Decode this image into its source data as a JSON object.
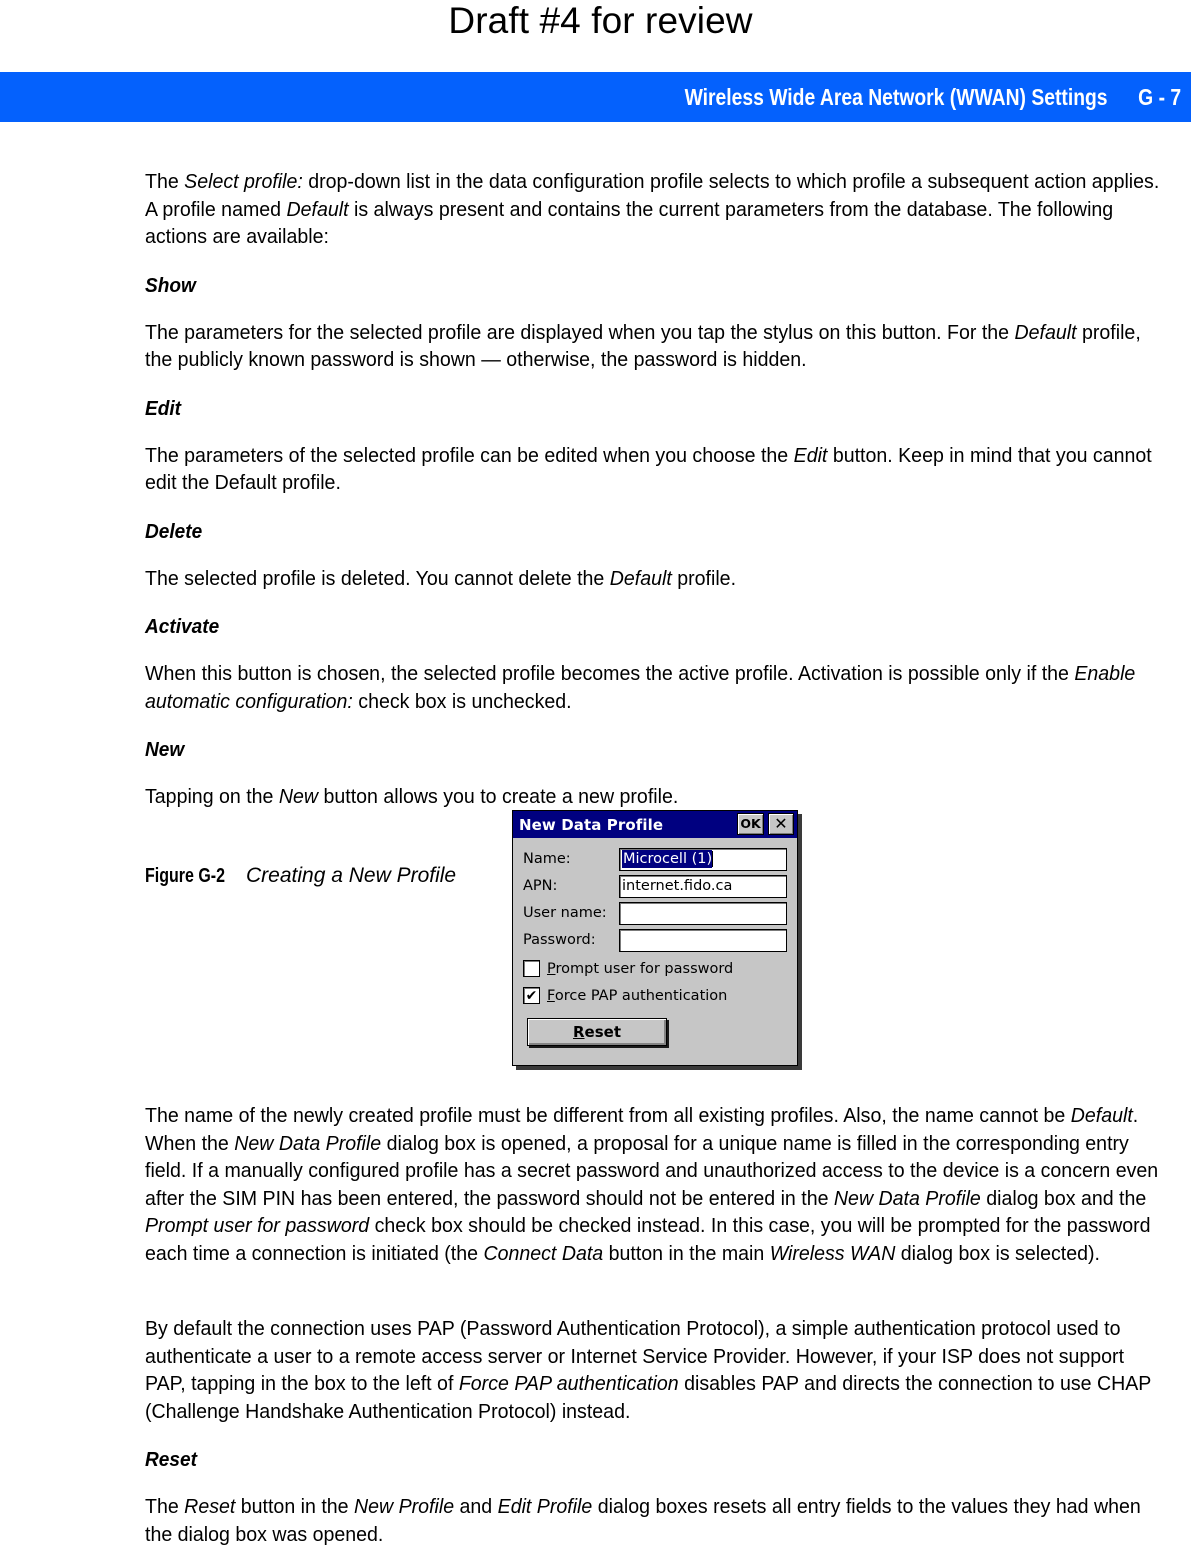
{
  "draft_note": "Draft #4 for review",
  "header": {
    "title": "Wireless Wide Area Network (WWAN) Settings",
    "page_number": "G - 7",
    "band_color": "#0461FD"
  },
  "body": {
    "intro_p1_a": "The ",
    "intro_p1_i1": "Select profile:",
    "intro_p1_b": " drop-down list in the data configuration profile selects to which profile a subsequent action applies. A profile named ",
    "intro_p1_i2": "Default",
    "intro_p1_c": " is always present and contains the current parameters from the database. The following actions are available:",
    "show_heading": "Show",
    "show_p_a": "The parameters for the selected profile are displayed when you tap the stylus on this button. For the ",
    "show_p_i1": "Default",
    "show_p_b": " profile, the publicly known password is shown — otherwise, the password is hidden.",
    "edit_heading": "Edit",
    "edit_p_a": "The parameters of the selected profile can be edited when you choose the ",
    "edit_p_i1": "Edit",
    "edit_p_b": " button. Keep in mind that you cannot edit the Default profile.",
    "delete_heading": "Delete",
    "delete_p_a": "The selected profile is deleted. You cannot delete the ",
    "delete_p_i1": "Default",
    "delete_p_b": " profile.",
    "activate_heading": "Activate",
    "activate_p_a": "When this button is chosen, the selected profile becomes the active profile. Activation is possible only if the ",
    "activate_p_i1": "Enable automatic configuration:",
    "activate_p_b": " check box is unchecked.",
    "new_heading": "New",
    "new_p_a": "Tapping on the ",
    "new_p_i1": "New",
    "new_p_b": " button allows you to create a new profile.",
    "after_fig_a": "The name of the newly created profile must be different from all existing profiles. Also, the name cannot be ",
    "after_fig_i1": "Default",
    "after_fig_b": ". When the ",
    "after_fig_i2": "New Data Profile",
    "after_fig_c": " dialog box is opened, a proposal for a unique name is filled in the corresponding entry field. If a manually configured profile has a secret password and unauthorized access to the device is a concern even after the SIM PIN has been entered, the password should not be entered in the ",
    "after_fig_i3": "New Data Profile",
    "after_fig_d": " dialog box and the ",
    "after_fig_i4": "Prompt user for password",
    "after_fig_e": " check box should be checked instead. In this case, you will be prompted for the password each time a connection is initiated (the ",
    "after_fig_i5": "Connect Data",
    "after_fig_f": " button in the main ",
    "after_fig_i6": "Wireless WAN",
    "after_fig_g": " dialog box is selected).",
    "pap_p_a": "By default the connection uses PAP (Password Authentication Protocol), a simple authentication protocol used to authenticate a user to a remote access server or Internet Service Provider. However, if your ISP does not support PAP, tapping in the box to the left of ",
    "pap_p_i1": "Force PAP authentication",
    "pap_p_b": " disables PAP and directs the connection to use CHAP (Challenge Handshake Authentication Protocol) instead.",
    "reset_heading": "Reset",
    "reset_p_a": "The ",
    "reset_p_i1": "Reset",
    "reset_p_b": " button in the ",
    "reset_p_i2": "New Profile",
    "reset_p_c": " and ",
    "reset_p_i3": "Edit Profile",
    "reset_p_d": " dialog boxes resets all entry fields to the values they had when the dialog box was opened."
  },
  "figure": {
    "label": "Figure G-2",
    "title": "Creating a New Profile"
  },
  "dialog": {
    "title": "New Data Profile",
    "ok_label": "OK",
    "close_label": "✕",
    "titlebar_color": "#000080",
    "face_color": "#c6c6c6",
    "fields": [
      {
        "label": "Name:",
        "value": "Microcell (1)",
        "selected": true,
        "placeholder": ""
      },
      {
        "label": "APN:",
        "value": "internet.fido.ca",
        "selected": false,
        "placeholder": ""
      },
      {
        "label": "User name:",
        "value": "",
        "selected": false,
        "placeholder": ""
      },
      {
        "label": "Password:",
        "value": "",
        "selected": false,
        "placeholder": ""
      }
    ],
    "checkboxes": [
      {
        "accel": "P",
        "rest": "rompt user for password",
        "checked": false,
        "mark": ""
      },
      {
        "accel": "F",
        "rest": "orce PAP authentication",
        "checked": true,
        "mark": "✔"
      }
    ],
    "reset_accel": "R",
    "reset_rest": "eset"
  }
}
